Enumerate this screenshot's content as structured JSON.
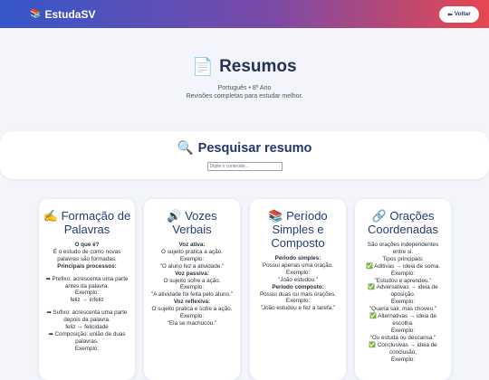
{
  "header": {
    "brand_icon": "📚",
    "brand": "EstudaSV",
    "back_icon": "⬅",
    "back_label": "Voltar"
  },
  "hero": {
    "icon": "📄",
    "title": "Resumos",
    "subtitle": "Português • 8º Ano",
    "description": "Revisões completas para estudar melhor."
  },
  "search": {
    "icon": "🔍",
    "title": "Pesquisar resumo",
    "placeholder": "Digite o conteúdo..."
  },
  "cards": [
    {
      "icon": "✍️",
      "title": "Formação de Palavras",
      "lines": [
        {
          "t": "O que é?",
          "b": true
        },
        {
          "t": "É o estudo de como novas palavras são formadas."
        },
        {
          "t": "Principais processos:",
          "b": true
        },
        {
          "t": "",
          "gap": true
        },
        {
          "t": "➡ Prefixo: acrescenta uma parte antes da palavra."
        },
        {
          "t": "Exemplo:"
        },
        {
          "t": "feliz → infeliz"
        },
        {
          "t": "",
          "gap": true
        },
        {
          "t": "➡ Sufixo: acrescenta uma parte depois da palavra."
        },
        {
          "t": "feliz → felicidade"
        },
        {
          "t": "➡ Composição: união de duas palavras."
        },
        {
          "t": "Exemplo:"
        }
      ]
    },
    {
      "icon": "🔊",
      "title": "Vozes Verbais",
      "lines": [
        {
          "t": "Voz ativa:",
          "b": true
        },
        {
          "t": "O sujeito pratica a ação."
        },
        {
          "t": "Exemplo:"
        },
        {
          "t": "\"O aluno fez a atividade.\""
        },
        {
          "t": "Voz passiva:",
          "b": true
        },
        {
          "t": "O sujeito sofre a ação."
        },
        {
          "t": "Exemplo:"
        },
        {
          "t": "\"A atividade foi feita pelo aluno.\""
        },
        {
          "t": "Voz reflexiva:",
          "b": true
        },
        {
          "t": "O sujeito pratica e sofre a ação."
        },
        {
          "t": "Exemplo:"
        },
        {
          "t": "\"Ela se machucou.\""
        }
      ]
    },
    {
      "icon": "📚",
      "title": "Período Simples e Composto",
      "lines": [
        {
          "t": "Período simples:",
          "b": true
        },
        {
          "t": "Possui apenas uma oração."
        },
        {
          "t": "Exemplo:"
        },
        {
          "t": "\"João estudou.\""
        },
        {
          "t": "Período composto:",
          "b": true
        },
        {
          "t": "Possui duas ou mais orações."
        },
        {
          "t": "Exemplo:"
        },
        {
          "t": "\"João estudou e fez a tarefa.\""
        }
      ]
    },
    {
      "icon": "🔗",
      "title": "Orações Coordenadas",
      "lines": [
        {
          "t": "São orações independentes entre si."
        },
        {
          "t": "Tipos principais:"
        },
        {
          "t": "✅ Aditivas → ideia de soma."
        },
        {
          "t": "Exemplo:"
        },
        {
          "t": "\"Estudou e aprendeu.\""
        },
        {
          "t": "✅ Adversativas → ideia de oposição."
        },
        {
          "t": "Exemplo:"
        },
        {
          "t": "\"Queria sair, mas choveu.\""
        },
        {
          "t": "✅ Alternativas → ideia de escolha."
        },
        {
          "t": "Exemplo:"
        },
        {
          "t": "\"Ou estuda ou descansa.\""
        },
        {
          "t": "✅ Conclusivas → ideia de conclusão."
        },
        {
          "t": "Exemplo:"
        }
      ]
    }
  ]
}
